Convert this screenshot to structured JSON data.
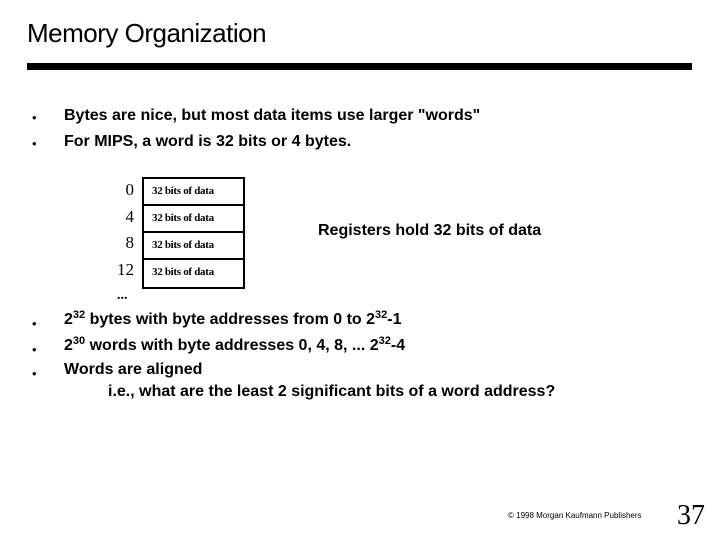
{
  "slide": {
    "title": "Memory Organization",
    "intro_bullets": [
      "Bytes are nice, but most data items use larger \"words\"",
      "For MIPS, a word is 32 bits or 4 bytes."
    ],
    "bullet_glyph": "•",
    "memory": {
      "rows": [
        {
          "address": "0",
          "content": "32 bits of data"
        },
        {
          "address": "4",
          "content": "32 bits of data"
        },
        {
          "address": "8",
          "content": "32 bits of data"
        },
        {
          "address": "12",
          "content": "32 bits of data"
        }
      ],
      "ellipsis": "..."
    },
    "register_note": "Registers hold 32 bits of data",
    "facts": [
      {
        "base": "2",
        "exp": "32",
        "text": " bytes with byte addresses from 0 to 2",
        "exp2": "32",
        "tail": "-1"
      },
      {
        "base": "2",
        "exp": "30",
        "text": " words with byte addresses 0, 4, 8, ... 2",
        "exp2": "32",
        "tail": "-4"
      },
      {
        "base": "Words are aligned",
        "exp": "",
        "text": "",
        "exp2": "",
        "tail": ""
      }
    ],
    "aligned_question": "i.e., what are the  least 2 significant bits of a word address?",
    "footer": "© 1998 Morgan Kaufmann Publishers",
    "page_number": "37"
  }
}
